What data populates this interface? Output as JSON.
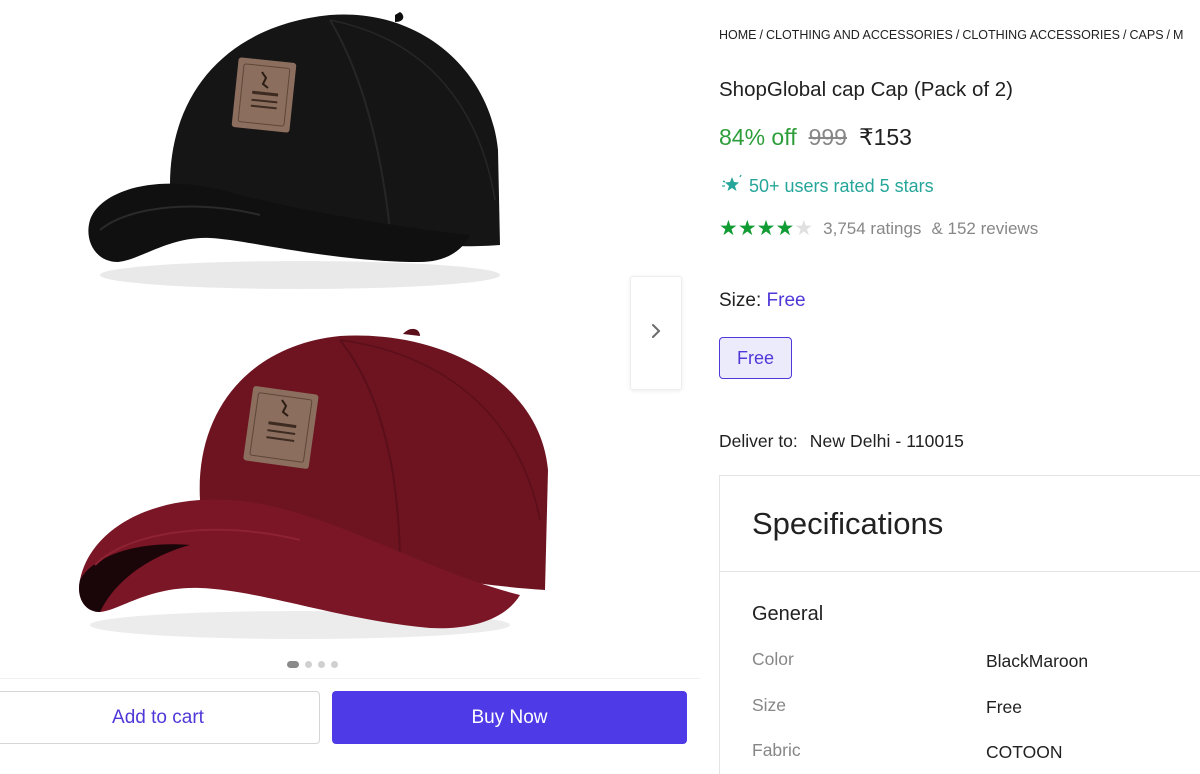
{
  "breadcrumb": [
    {
      "label": "HOME"
    },
    {
      "label": "CLOTHING AND ACCESSORIES"
    },
    {
      "label": "CLOTHING ACCESSORIES"
    },
    {
      "label": "CAPS"
    },
    {
      "label": "M"
    }
  ],
  "product": {
    "title": "ShopGlobal cap Cap (Pack of 2)",
    "discount": "84% off",
    "mrp": "999",
    "price": "₹153",
    "badge_text": "50+ users rated 5 stars",
    "rating": {
      "stars_filled": 4,
      "stars_total": 5,
      "ratings_text": "3,754 ratings",
      "reviews_text": "& 152 reviews"
    }
  },
  "size": {
    "label": "Size:",
    "selected": "Free",
    "options": [
      "Free"
    ]
  },
  "delivery": {
    "label": "Deliver to:",
    "location": "New Delhi - 110015"
  },
  "specifications": {
    "heading": "Specifications",
    "group": "General",
    "rows": [
      {
        "key": "Color",
        "value": "BlackMaroon"
      },
      {
        "key": "Size",
        "value": "Free"
      },
      {
        "key": "Fabric",
        "value": "COTOON"
      }
    ]
  },
  "gallery": {
    "images_total": 4,
    "active_index": 0,
    "next_icon": "chevron-right-icon"
  },
  "actions": {
    "add_to_cart": "Add to cart",
    "buy_now": "Buy Now"
  },
  "colors": {
    "accent": "#4f3ae8",
    "discount_green": "#2e9e3b",
    "star_green": "#119b33",
    "badge_teal": "#26a69a"
  }
}
